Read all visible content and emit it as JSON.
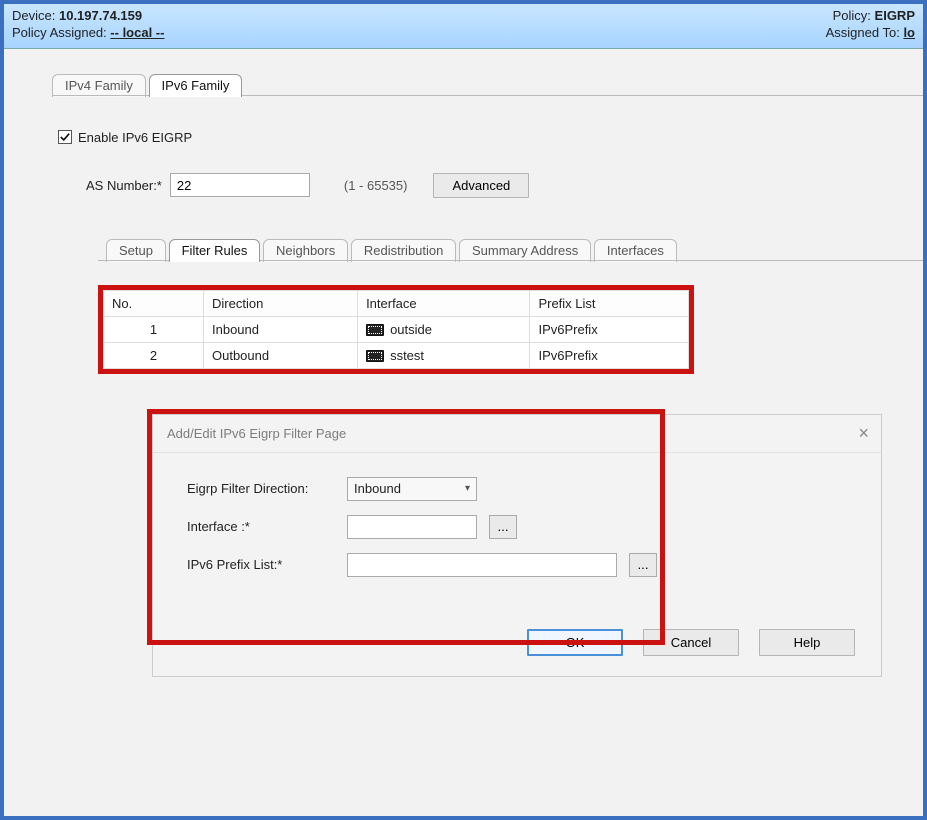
{
  "header": {
    "device_label": "Device:",
    "device_value": "10.197.74.159",
    "policy_assigned_label": "Policy Assigned:",
    "policy_assigned_value": "-- local --",
    "policy_label": "Policy:",
    "policy_value": "EIGRP",
    "assigned_to_label": "Assigned To:",
    "assigned_to_value": "lo"
  },
  "outer_tabs": {
    "ipv4": "IPv4 Family",
    "ipv6": "IPv6 Family"
  },
  "enable_checkbox": {
    "label": "Enable IPv6 EIGRP",
    "checked": true
  },
  "as_row": {
    "label": "AS Number:*",
    "value": "22",
    "range": "(1 - 65535)",
    "advanced_btn": "Advanced"
  },
  "inner_tabs": {
    "setup": "Setup",
    "filter_rules": "Filter Rules",
    "neighbors": "Neighbors",
    "redistribution": "Redistribution",
    "summary": "Summary Address",
    "interfaces": "Interfaces"
  },
  "filter_table": {
    "headers": {
      "no": "No.",
      "direction": "Direction",
      "interface": "Interface",
      "prefix": "Prefix List"
    },
    "rows": [
      {
        "no": "1",
        "direction": "Inbound",
        "interface": "outside",
        "prefix": "IPv6Prefix"
      },
      {
        "no": "2",
        "direction": "Outbound",
        "interface": "sstest",
        "prefix": "IPv6Prefix"
      }
    ]
  },
  "dialog": {
    "title": "Add/Edit IPv6 Eigrp Filter Page",
    "direction_label": "Eigrp Filter Direction:",
    "direction_value": "Inbound",
    "interface_label": "Interface :*",
    "interface_value": "",
    "prefix_label": "IPv6 Prefix List:*",
    "prefix_value": "",
    "ellipsis": "...",
    "ok": "OK",
    "cancel": "Cancel",
    "help": "Help"
  }
}
